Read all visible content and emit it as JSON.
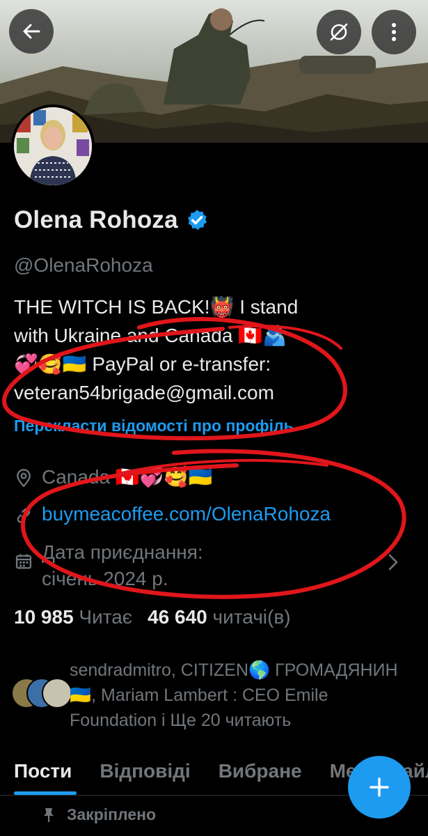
{
  "profile": {
    "name": "Olena Rohoza",
    "handle": "@OlenaRohoza",
    "bio": "THE WITCH IS BACK!👹  I stand\nwith Ukraine and Canada 🇨🇦🫂\n💞🥰🇺🇦  PayPal or e-transfer:\nveteran54brigade@gmail.com",
    "translate_link": "Перекласти відомості про профіль",
    "location": "Canada 🇨🇦💞🥰🇺🇦",
    "website": "buymeacoffee.com/OlenaRohoza",
    "joined": "Дата приєднання: січень 2024 р.",
    "verified": true
  },
  "stats": {
    "following_count": "10 985",
    "following_label": "Читає",
    "followers_count": "46 640",
    "followers_label": "читачі(в)"
  },
  "followed_by": "sendradmitro, CITIZEN🌎 ГРОМАДЯНИН🇺🇦, Mariam Lambert : CEO Emile Foundation і Ще 20 читають",
  "tabs": [
    {
      "label": "Пости",
      "active": true
    },
    {
      "label": "Відповіді",
      "active": false
    },
    {
      "label": "Вибране",
      "active": false
    },
    {
      "label": "Медіафайли",
      "active": false
    }
  ],
  "pinned_label": "Закріплено",
  "icons": {
    "back": "arrow-left-icon",
    "grok": "grok-icon",
    "more": "more-vertical-icon",
    "location": "location-pin-icon",
    "link": "link-icon",
    "calendar": "calendar-icon",
    "pin": "pin-icon",
    "compose": "plus-icon"
  },
  "colors": {
    "accent": "#1d9bf0",
    "background": "#000000",
    "muted": "#71767b",
    "annotation": "#e0161b"
  }
}
